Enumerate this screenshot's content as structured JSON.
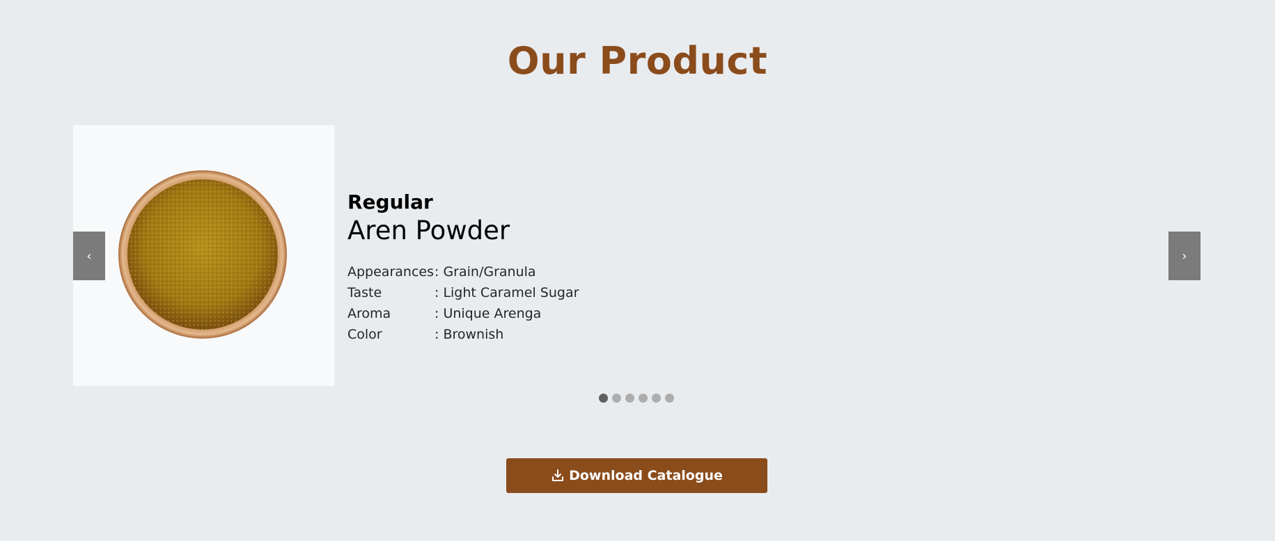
{
  "section": {
    "title": "Our Product"
  },
  "carousel": {
    "prev_label": "‹",
    "next_label": "›",
    "active_index": 0,
    "slide_count": 6
  },
  "product": {
    "variant": "Regular",
    "name": "Aren Powder",
    "specs": [
      {
        "key": "Appearances",
        "value": ": Grain/Granula"
      },
      {
        "key": "Taste",
        "value": ": Light Caramel Sugar"
      },
      {
        "key": "Aroma",
        "value": ": Unique Arenga"
      },
      {
        "key": "Color",
        "value": ": Brownish"
      }
    ]
  },
  "download": {
    "label": "Download Catalogue",
    "icon": "download-icon"
  },
  "colors": {
    "brand": "#8b4c1c",
    "background": "#e9ecef",
    "control": "#7b7b7b"
  }
}
